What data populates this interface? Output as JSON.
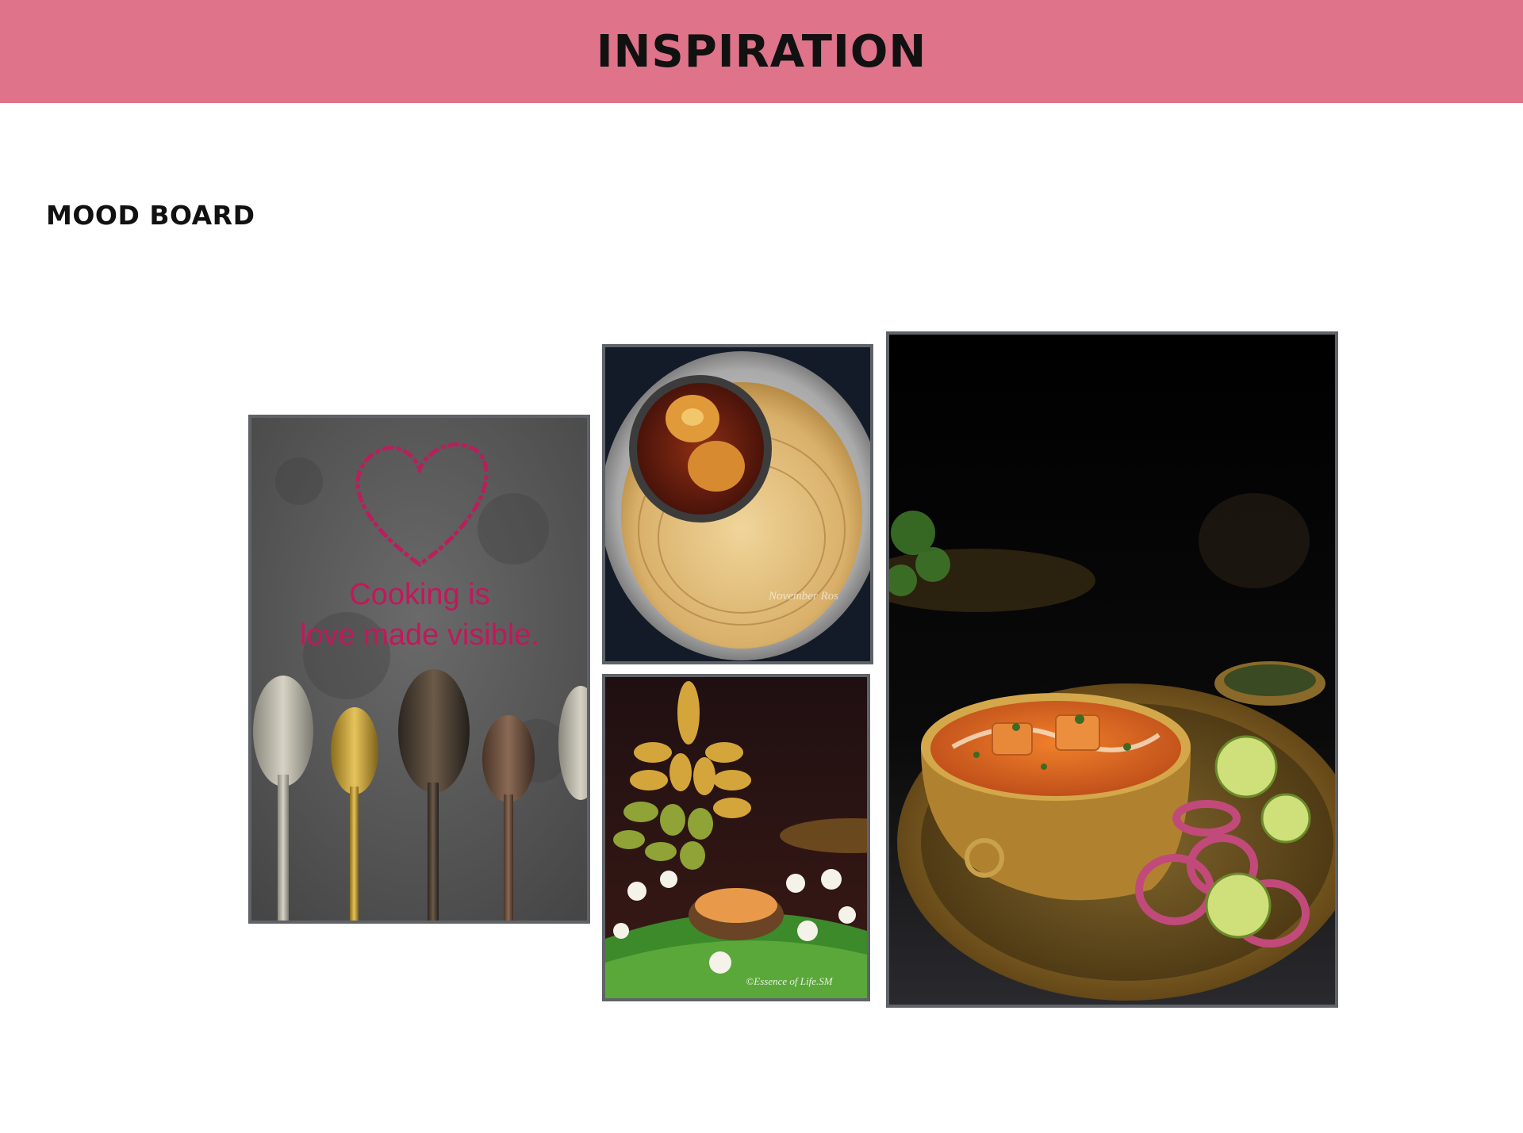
{
  "header": {
    "title": "INSPIRATION",
    "bg_color": "#de738a"
  },
  "section": {
    "title": "MOOD BOARD"
  },
  "mood_board": {
    "border_color": "#5f6368",
    "quote_card": {
      "line1": "Cooking is",
      "line2": "love made visible.",
      "text_color": "#c2185b",
      "icon": "heart-icon"
    },
    "photos": [
      {
        "name": "spoons-quote-photo"
      },
      {
        "name": "egg-curry-paratha-photo",
        "watermark": "November Ros"
      },
      {
        "name": "bananas-jasmine-photo",
        "watermark": "©Essence of Life.SM"
      },
      {
        "name": "paneer-butter-masala-photo"
      }
    ]
  }
}
